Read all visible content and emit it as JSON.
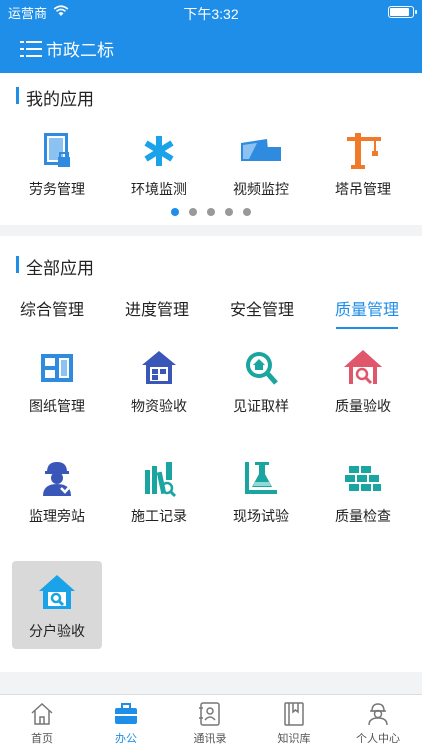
{
  "status": {
    "carrier": "运营商",
    "time": "下午3:32"
  },
  "header": {
    "title": "市政二标"
  },
  "my_apps": {
    "title": "我的应用",
    "items": [
      {
        "label": "劳务管理",
        "icon": "labor-icon"
      },
      {
        "label": "环境监测",
        "icon": "asterisk-icon"
      },
      {
        "label": "视频监控",
        "icon": "camera-icon"
      },
      {
        "label": "塔吊管理",
        "icon": "crane-icon"
      }
    ],
    "pages": 5,
    "current_page": 1
  },
  "all_apps": {
    "title": "全部应用",
    "tabs": [
      "综合管理",
      "进度管理",
      "安全管理",
      "质量管理"
    ],
    "active_tab": "质量管理",
    "items": [
      {
        "label": "图纸管理",
        "icon": "drawing-icon"
      },
      {
        "label": "物资验收",
        "icon": "warehouse-icon"
      },
      {
        "label": "见证取样",
        "icon": "magnifier-house-icon"
      },
      {
        "label": "质量验收",
        "icon": "house-search-icon"
      },
      {
        "label": "监理旁站",
        "icon": "worker-icon"
      },
      {
        "label": "施工记录",
        "icon": "books-icon"
      },
      {
        "label": "现场试验",
        "icon": "flask-icon"
      },
      {
        "label": "质量检查",
        "icon": "bricks-icon"
      },
      {
        "label": "分户验收",
        "icon": "house-check-icon"
      }
    ]
  },
  "tabbar": {
    "items": [
      {
        "label": "首页",
        "icon": "home-icon"
      },
      {
        "label": "办公",
        "icon": "briefcase-icon"
      },
      {
        "label": "通讯录",
        "icon": "contacts-icon"
      },
      {
        "label": "知识库",
        "icon": "book-icon"
      },
      {
        "label": "个人中心",
        "icon": "person-icon"
      }
    ],
    "active": "办公"
  },
  "colors": {
    "primary": "#1f8ee8",
    "orange": "#f07a2a",
    "pink": "#e0566a",
    "teal": "#1aa5a0"
  }
}
